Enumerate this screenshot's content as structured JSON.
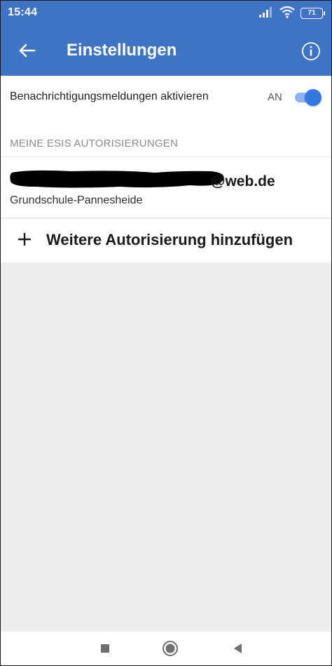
{
  "status_bar": {
    "time": "15:44",
    "battery": "71"
  },
  "app_bar": {
    "title": "Einstellungen"
  },
  "notifications": {
    "label": "Benachrichtigungsmeldungen aktivieren",
    "state_label": "AN",
    "enabled": true
  },
  "authorizations": {
    "section_title": "MEINE ESIS AUTORISIERUNGEN",
    "items": [
      {
        "email_visible": "@web.de",
        "school": "Grundschule-Pannesheide"
      }
    ],
    "add_label": "Weitere Autorisierung hinzufügen"
  },
  "icons": {
    "back": "arrow-left-icon",
    "info": "info-icon",
    "add": "plus-icon",
    "nav_recent": "square-icon",
    "nav_home": "circle-icon",
    "nav_back": "triangle-left-icon"
  },
  "colors": {
    "primary": "#3f74c4",
    "toggle_on": "#3378e0",
    "background": "#ededed"
  }
}
